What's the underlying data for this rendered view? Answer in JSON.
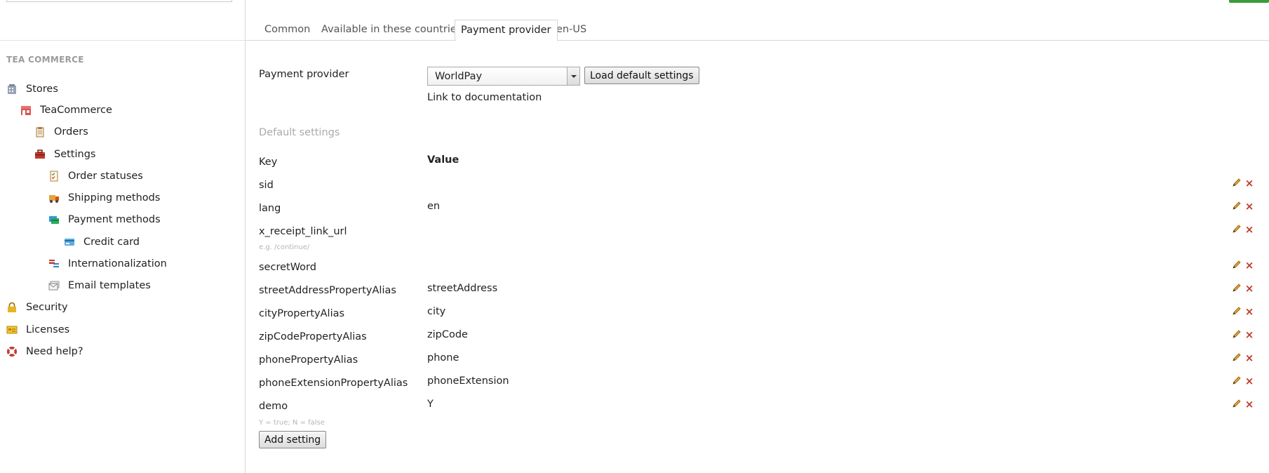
{
  "sidebar": {
    "heading": "TEA COMMERCE",
    "items": [
      {
        "label": "Stores",
        "icon": "building-icon"
      },
      {
        "label": "TeaCommerce",
        "icon": "store-icon"
      },
      {
        "label": "Orders",
        "icon": "clipboard-icon"
      },
      {
        "label": "Settings",
        "icon": "toolbox-icon"
      },
      {
        "label": "Order statuses",
        "icon": "checklist-icon"
      },
      {
        "label": "Shipping methods",
        "icon": "truck-icon"
      },
      {
        "label": "Payment methods",
        "icon": "payment-icon"
      },
      {
        "label": "Credit card",
        "icon": "credit-card-icon"
      },
      {
        "label": "Internationalization",
        "icon": "flags-icon"
      },
      {
        "label": "Email templates",
        "icon": "email-icon"
      },
      {
        "label": "Security",
        "icon": "lock-icon"
      },
      {
        "label": "Licenses",
        "icon": "license-icon"
      },
      {
        "label": "Need help?",
        "icon": "lifebuoy-icon"
      }
    ]
  },
  "tabs": [
    {
      "label": "Common"
    },
    {
      "label": "Available in these countries"
    },
    {
      "label": "Payment provider",
      "active": true
    },
    {
      "label": "en-US"
    }
  ],
  "payment": {
    "label": "Payment provider",
    "selected": "WorldPay",
    "load_defaults": "Load default settings",
    "doc_link": "Link to documentation"
  },
  "defaults": {
    "title": "Default settings",
    "key_header": "Key",
    "value_header": "Value",
    "rows": [
      {
        "key": "sid",
        "value": "",
        "hint": ""
      },
      {
        "key": "lang",
        "value": "en",
        "hint": ""
      },
      {
        "key": "x_receipt_link_url",
        "value": "",
        "hint": "e.g. /continue/"
      },
      {
        "key": "secretWord",
        "value": "",
        "hint": ""
      },
      {
        "key": "streetAddressPropertyAlias",
        "value": "streetAddress",
        "hint": ""
      },
      {
        "key": "cityPropertyAlias",
        "value": "city",
        "hint": ""
      },
      {
        "key": "zipCodePropertyAlias",
        "value": "zipCode",
        "hint": ""
      },
      {
        "key": "phonePropertyAlias",
        "value": "phone",
        "hint": ""
      },
      {
        "key": "phoneExtensionPropertyAlias",
        "value": "phoneExtension",
        "hint": ""
      },
      {
        "key": "demo",
        "value": "Y",
        "hint": "Y = true; N = false"
      }
    ],
    "add_label": "Add setting"
  },
  "colors": {
    "accent_green": "#3a9d3a",
    "delete_red": "#c0392b",
    "muted": "#aaaaaa"
  }
}
